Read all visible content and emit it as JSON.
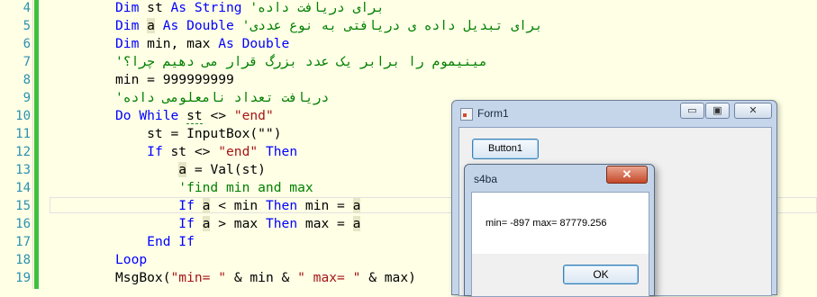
{
  "editor": {
    "lines": [
      {
        "num": "4",
        "parts": [
          {
            "t": "Dim ",
            "c": "kw"
          },
          {
            "t": "st ",
            "c": ""
          },
          {
            "t": "As String",
            "c": "kw"
          },
          {
            "t": " '",
            "c": "cm"
          }
        ],
        "rtl": "برای دریافت داده"
      },
      {
        "num": "5",
        "parts": [
          {
            "t": "Dim ",
            "c": "kw"
          },
          {
            "t": "a",
            "c": "hl"
          },
          {
            "t": " ",
            "c": ""
          },
          {
            "t": "As Double",
            "c": "kw"
          },
          {
            "t": " '",
            "c": "cm"
          }
        ],
        "rtl": "برای تبدیل داده ی دریافتی به نوع عددی"
      },
      {
        "num": "6",
        "parts": [
          {
            "t": "Dim ",
            "c": "kw"
          },
          {
            "t": "min, max ",
            "c": ""
          },
          {
            "t": "As Double",
            "c": "kw"
          }
        ],
        "rtl": ""
      },
      {
        "num": "7",
        "parts": [
          {
            "t": "'",
            "c": "cm"
          }
        ],
        "rtl": "مینیموم را برابر یک عدد بزرگ قرار می دهیم چرا؟"
      },
      {
        "num": "8",
        "parts": [
          {
            "t": "min = 999999999",
            "c": ""
          }
        ],
        "rtl": ""
      },
      {
        "num": "9",
        "parts": [
          {
            "t": "'",
            "c": "cm"
          }
        ],
        "rtl": "دریافت تعداد نامعلومی داده"
      },
      {
        "num": "10",
        "parts": [
          {
            "t": "Do While ",
            "c": "kw"
          },
          {
            "t": "st",
            "c": "squig"
          },
          {
            "t": " <> ",
            "c": ""
          },
          {
            "t": "\"end\"",
            "c": "str"
          }
        ],
        "rtl": ""
      },
      {
        "num": "11",
        "parts": [
          {
            "t": "    st = InputBox(\"\")",
            "c": ""
          }
        ],
        "rtl": ""
      },
      {
        "num": "12",
        "parts": [
          {
            "t": "    ",
            "c": ""
          },
          {
            "t": "If ",
            "c": "kw"
          },
          {
            "t": "st <> ",
            "c": ""
          },
          {
            "t": "\"end\"",
            "c": "str"
          },
          {
            "t": " Then",
            "c": "kw"
          }
        ],
        "rtl": ""
      },
      {
        "num": "13",
        "parts": [
          {
            "t": "        ",
            "c": ""
          },
          {
            "t": "a",
            "c": "hl"
          },
          {
            "t": " = Val(st)",
            "c": ""
          }
        ],
        "rtl": ""
      },
      {
        "num": "14",
        "parts": [
          {
            "t": "        'find min and max",
            "c": "cm"
          }
        ],
        "rtl": ""
      },
      {
        "num": "15",
        "parts": [
          {
            "t": "        ",
            "c": ""
          },
          {
            "t": "If ",
            "c": "kw"
          },
          {
            "t": "a",
            "c": "hl"
          },
          {
            "t": " < min ",
            "c": ""
          },
          {
            "t": "Then",
            "c": "kw"
          },
          {
            "t": " min = ",
            "c": ""
          },
          {
            "t": "a",
            "c": "hl"
          }
        ],
        "rtl": ""
      },
      {
        "num": "16",
        "parts": [
          {
            "t": "        ",
            "c": ""
          },
          {
            "t": "If ",
            "c": "kw"
          },
          {
            "t": "a",
            "c": "hl"
          },
          {
            "t": " > max ",
            "c": ""
          },
          {
            "t": "Then",
            "c": "kw"
          },
          {
            "t": " max = ",
            "c": ""
          },
          {
            "t": "a",
            "c": "hl"
          }
        ],
        "rtl": ""
      },
      {
        "num": "17",
        "parts": [
          {
            "t": "    ",
            "c": ""
          },
          {
            "t": "End If",
            "c": "kw"
          }
        ],
        "rtl": ""
      },
      {
        "num": "18",
        "parts": [
          {
            "t": "Loop",
            "c": "kw"
          }
        ],
        "rtl": ""
      },
      {
        "num": "19",
        "parts": [
          {
            "t": "MsgBox(",
            "c": ""
          },
          {
            "t": "\"min= \"",
            "c": "str"
          },
          {
            "t": " & min & ",
            "c": ""
          },
          {
            "t": "\" max= \"",
            "c": "str"
          },
          {
            "t": " & max)",
            "c": ""
          }
        ],
        "rtl": ""
      }
    ]
  },
  "form1": {
    "title": "Form1",
    "minimize_label": "▭",
    "maximize_label": "▣",
    "close_label": "✕",
    "button1_label": "Button1"
  },
  "msgbox": {
    "title": "s4ba",
    "close_label": "✕",
    "message": "min= -897 max= 87779.256",
    "ok_label": "OK"
  }
}
